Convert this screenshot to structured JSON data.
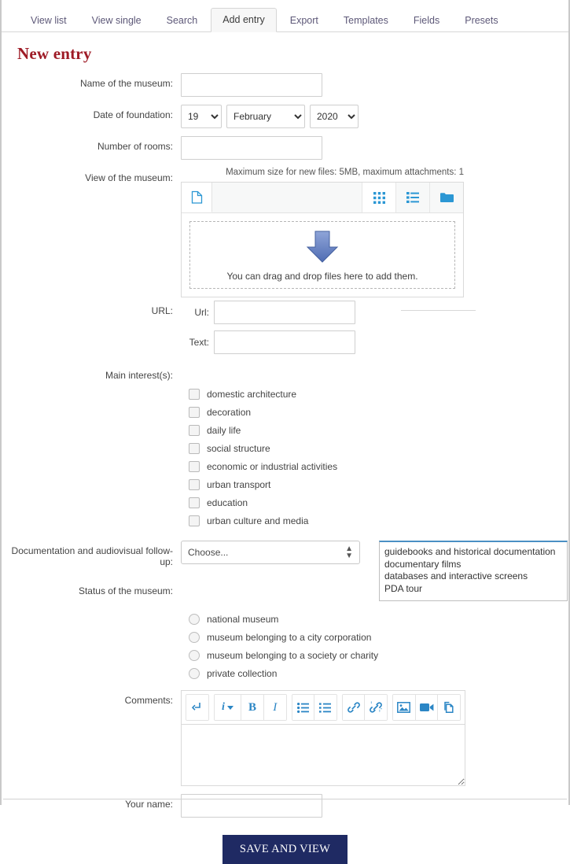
{
  "tabs": [
    {
      "label": "View list",
      "active": false
    },
    {
      "label": "View single",
      "active": false
    },
    {
      "label": "Search",
      "active": false
    },
    {
      "label": "Add entry",
      "active": true
    },
    {
      "label": "Export",
      "active": false
    },
    {
      "label": "Templates",
      "active": false
    },
    {
      "label": "Fields",
      "active": false
    },
    {
      "label": "Presets",
      "active": false
    }
  ],
  "heading": "New entry",
  "fields": {
    "name_label": "Name of the museum:",
    "name_value": "",
    "date_label": "Date of foundation:",
    "date_day": "19",
    "date_month": "February",
    "date_year": "2020",
    "rooms_label": "Number of rooms:",
    "rooms_value": "",
    "view_label": "View of the museum:",
    "url_label": "URL:",
    "url_sub_label": "Url:",
    "url_value": "",
    "text_sub_label": "Text:",
    "text_value": "",
    "interest_label": "Main interest(s):",
    "doc_label": "Documentation and audiovisual follow-up:",
    "status_label": "Status of the museum:",
    "comments_label": "Comments:",
    "comments_value": "",
    "yourname_label": "Your name:",
    "yourname_value": ""
  },
  "filemanager": {
    "max_text": "Maximum size for new files: 5MB, maximum attachments: 1",
    "drop_text": "You can drag and drop files here to add them.",
    "icons": {
      "file_tab": "file-icon",
      "grid": "grid-view-icon",
      "list": "list-view-icon",
      "folder": "folder-icon",
      "arrow": "down-arrow-icon"
    }
  },
  "interests": [
    "domestic architecture",
    "decoration",
    "daily life",
    "social structure",
    "economic or industrial activities",
    "urban transport",
    "education",
    "urban culture and media"
  ],
  "documentation": {
    "select_value": "Choose...",
    "options": [
      "guidebooks and historical documentation",
      "documentary films",
      "databases and interactive screens",
      "PDA tour"
    ]
  },
  "status_options": [
    "national museum",
    "museum belonging to a city corporation",
    "museum belonging to a society or charity",
    "private collection"
  ],
  "editor_toolbar": [
    {
      "name": "undo-return-icon",
      "glyph": "↳"
    },
    {
      "name": "info-dropdown-icon",
      "glyph": "i"
    },
    {
      "name": "bold-icon",
      "glyph": "B"
    },
    {
      "name": "italic-icon",
      "glyph": "I"
    },
    {
      "name": "bullet-list-icon",
      "glyph": "☰"
    },
    {
      "name": "numbered-list-icon",
      "glyph": "≡"
    },
    {
      "name": "link-icon",
      "glyph": "🔗"
    },
    {
      "name": "unlink-icon",
      "glyph": "✂"
    },
    {
      "name": "image-icon",
      "glyph": "🖼"
    },
    {
      "name": "video-icon",
      "glyph": "🎥"
    },
    {
      "name": "manage-files-icon",
      "glyph": "⧉"
    }
  ],
  "save_button": "SAVE AND VIEW",
  "colors": {
    "heading": "#9e1b26",
    "tab_link": "#5d5878",
    "accent_blue": "#2b86c5",
    "save_bg": "#1f2a63",
    "listbox_top_border": "#4a90c4"
  }
}
